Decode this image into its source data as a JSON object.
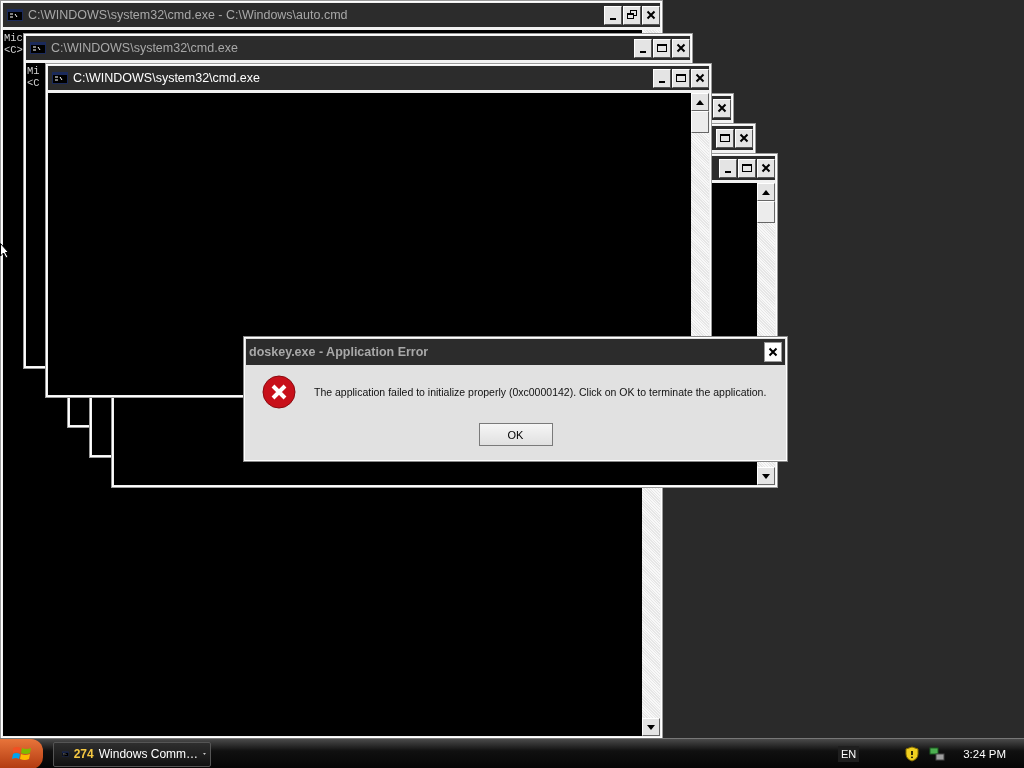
{
  "windows": [
    {
      "title": "C:\\WINDOWS\\system32\\cmd.exe - C:\\Windows\\auto.cmd",
      "active": false,
      "buttons": [
        {
          "kind": "minimize"
        },
        {
          "kind": "restore"
        },
        {
          "kind": "close"
        }
      ],
      "console_lines": [
        "Mic",
        "<C>"
      ]
    },
    {
      "title": "C:\\WINDOWS\\system32\\cmd.exe",
      "active": false,
      "buttons": [
        {
          "kind": "minimize"
        },
        {
          "kind": "maximize"
        },
        {
          "kind": "close"
        }
      ],
      "console_lines": [
        "Mi",
        "<C"
      ]
    },
    {
      "buttons": [
        {
          "kind": "close"
        }
      ]
    },
    {
      "buttons": [
        {
          "kind": "maximize"
        },
        {
          "kind": "close"
        }
      ]
    },
    {
      "buttons": [
        {
          "kind": "minimize"
        },
        {
          "kind": "maximize"
        },
        {
          "kind": "close"
        }
      ]
    },
    {
      "title": "C:\\WINDOWS\\system32\\cmd.exe",
      "active": true,
      "buttons": [
        {
          "kind": "minimize"
        },
        {
          "kind": "maximize"
        },
        {
          "kind": "close"
        }
      ]
    }
  ],
  "dialog": {
    "title": "doskey.exe - Application Error",
    "message": "The application failed to initialize properly (0xc0000142). Click on OK to terminate the application.",
    "buttons": [
      "OK"
    ]
  },
  "taskbar": {
    "task": {
      "count": "274",
      "label": "Windows Comm…"
    },
    "language": "EN",
    "clock": "3:24 PM"
  }
}
